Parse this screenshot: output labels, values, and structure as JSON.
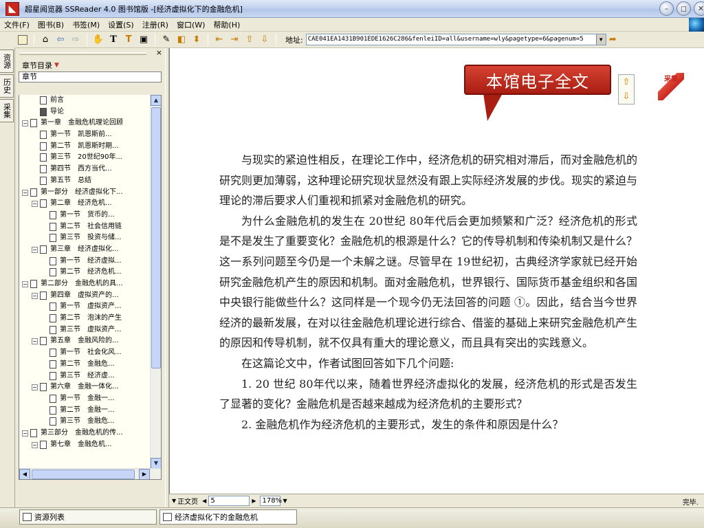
{
  "window": {
    "title": "超星阅览器 SSReader 4.0 图书馆版 -[经济虚拟化下的金融危机]"
  },
  "menu": [
    "文件(F)",
    "图书(B)",
    "书签(M)",
    "设置(S)",
    "注册(R)",
    "窗口(W)",
    "帮助(H)"
  ],
  "toolbar": {
    "address_label": "地址:",
    "address_value": "CAE041EA1431B901EDE1626C286&fenleiID=all&username=wly&pagetype=6&pagenum=5"
  },
  "side_tabs": [
    "资源",
    "历史",
    "采集"
  ],
  "panel": {
    "title": "章节目录",
    "tree_header": "章节",
    "items": [
      {
        "label": "前言",
        "level": 1,
        "toggle": ""
      },
      {
        "label": "导论",
        "level": 1,
        "toggle": "",
        "dark": true
      },
      {
        "label": "第一章　金融危机理论回顾",
        "level": 0,
        "toggle": "−"
      },
      {
        "label": "第一节　凯恩斯前...",
        "level": 1,
        "toggle": ""
      },
      {
        "label": "第二节　凯恩斯时期...",
        "level": 1,
        "toggle": ""
      },
      {
        "label": "第三节　20世纪90年...",
        "level": 1,
        "toggle": ""
      },
      {
        "label": "第四节　西方当代...",
        "level": 1,
        "toggle": ""
      },
      {
        "label": "第五节　总结",
        "level": 1,
        "toggle": ""
      },
      {
        "label": "第一部分　经济虚拟化下...",
        "level": 0,
        "toggle": "−"
      },
      {
        "label": "第二章　经济危机...",
        "level": 1,
        "toggle": "−"
      },
      {
        "label": "第一节　货币的...",
        "level": 2,
        "toggle": ""
      },
      {
        "label": "第二节　社会信用链",
        "level": 2,
        "toggle": ""
      },
      {
        "label": "第三节　投资与储...",
        "level": 2,
        "toggle": ""
      },
      {
        "label": "第三章　经济虚拟化...",
        "level": 1,
        "toggle": "−"
      },
      {
        "label": "第一节　经济虚拟...",
        "level": 2,
        "toggle": ""
      },
      {
        "label": "第二节　经济危机...",
        "level": 2,
        "toggle": ""
      },
      {
        "label": "第二部分　金融危机的具...",
        "level": 0,
        "toggle": "−"
      },
      {
        "label": "第四章　虚拟资产的...",
        "level": 1,
        "toggle": "−"
      },
      {
        "label": "第一节　虚拟资产...",
        "level": 2,
        "toggle": ""
      },
      {
        "label": "第二节　泡沫的产生",
        "level": 2,
        "toggle": ""
      },
      {
        "label": "第三节　虚拟资产...",
        "level": 2,
        "toggle": ""
      },
      {
        "label": "第五章　金融风险的...",
        "level": 1,
        "toggle": "−"
      },
      {
        "label": "第一节　社会化风...",
        "level": 2,
        "toggle": ""
      },
      {
        "label": "第二节　金融危...",
        "level": 2,
        "toggle": ""
      },
      {
        "label": "第三节　经济虚...",
        "level": 2,
        "toggle": ""
      },
      {
        "label": "第六章　金融一体化...",
        "level": 1,
        "toggle": "−"
      },
      {
        "label": "第一节　金融一...",
        "level": 2,
        "toggle": ""
      },
      {
        "label": "第二节　金融一...",
        "level": 2,
        "toggle": ""
      },
      {
        "label": "第三节　金融危...",
        "level": 2,
        "toggle": ""
      },
      {
        "label": "第三部分　金融危机的传...",
        "level": 0,
        "toggle": "−"
      },
      {
        "label": "第七章　金融危机...",
        "level": 1,
        "toggle": "−"
      }
    ]
  },
  "document": {
    "callout": "本馆电子全文",
    "logo_text": "采集",
    "paragraphs": [
      "与现实的紧迫性相反，在理论工作中，经济危机的研究相对滞后，而对金融危机的研究则更加薄弱，这种理论研究现状显然没有跟上实际经济发展的步伐。现实的紧迫与理论的滞后要求人们重视和抓紧对金融危机的研究。",
      "为什么金融危机的发生在 20世纪 80年代后会更加频繁和广泛？经济危机的形式是不是发生了重要变化？金融危机的根源是什么？它的传导机制和传染机制又是什么？这一系列问题至今仍是一个未解之谜。尽管早在 19世纪初，古典经济学家就已经开始研究金融危机产生的原因和机制。面对金融危机，世界银行、国际货币基金组织和各国中央银行能做些什么？这同样是一个现今仍无法回答的问题 ①。因此，结合当今世界经济的最新发展，在对以往金融危机理论进行综合、借鉴的基础上来研究金融危机产生的原因和传导机制，就不仅具有重大的理论意义，而且具有突出的实践意义。",
      "在这篇论文中，作者试图回答如下几个问题:",
      "1. 20 世纪 80年代以来，随着世界经济虚拟化的发展，经济危机的形式是否发生了显著的变化？金融危机是否越来越成为经济危机的主要形式？",
      "2. 金融危机作为经济危机的主要形式，发生的条件和原因是什么？"
    ]
  },
  "status": {
    "page_mode": "正文页",
    "page_number": "5",
    "zoom": "178%",
    "state": "完毕."
  },
  "bottom_tabs": {
    "resource_list": "资源列表",
    "open_book": "经济虚拟化下的金融危机"
  }
}
